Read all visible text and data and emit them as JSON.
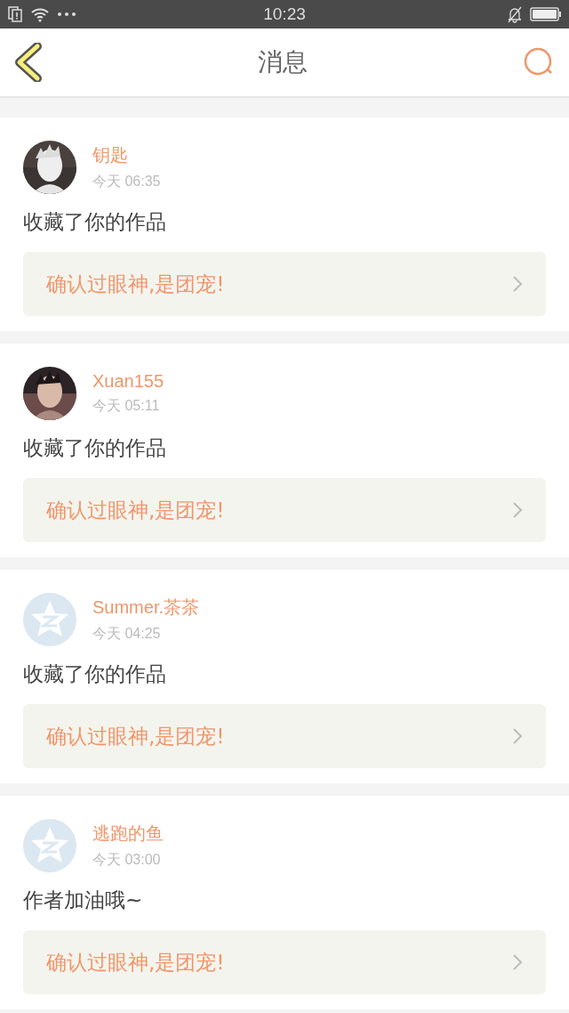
{
  "status_bar": {
    "time": "10:23"
  },
  "header": {
    "title": "消息"
  },
  "messages": [
    {
      "name": "钥匙",
      "time": "今天 06:35",
      "text": "收藏了你的作品",
      "work": "确认过眼神,是团宠!"
    },
    {
      "name": "Xuan155",
      "time": "今天 05:11",
      "text": "收藏了你的作品",
      "work": "确认过眼神,是团宠!"
    },
    {
      "kind": "default",
      "name": "Summer.茶茶",
      "time": "今天 04:25",
      "text": "收藏了你的作品",
      "work": "确认过眼神,是团宠!"
    },
    {
      "kind": "default",
      "name": "逃跑的鱼",
      "time": "今天 03:00",
      "text": "作者加油哦~",
      "work": "确认过眼神,是团宠!"
    }
  ]
}
